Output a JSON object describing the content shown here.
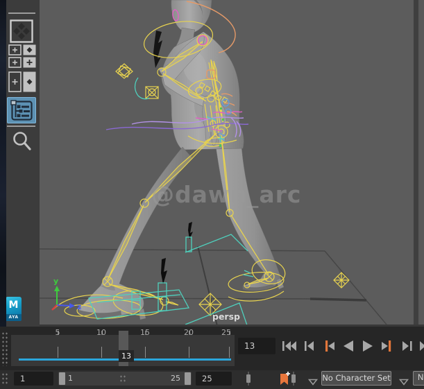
{
  "sidebar": {
    "maya_logo": {
      "m": "M",
      "sub": "AYA"
    }
  },
  "viewport": {
    "camera_label": "persp",
    "watermark": "@dawn_arc",
    "axis_labels": {
      "y": "y",
      "z": "z"
    }
  },
  "timeline": {
    "ticks": [
      "5",
      "10",
      "15",
      "20",
      "25"
    ],
    "playhead_frame": "13",
    "frame_field_value": "13"
  },
  "range_bar": {
    "start_field": "1",
    "slider_start_label": "1",
    "slider_end_label": "25",
    "end_field": "25",
    "character_set_label": "No Character Set",
    "clipped_label": "N"
  },
  "colors": {
    "cached_playback_cyan": "#2ba7dc",
    "selected_tool_blue": "#5d92b4",
    "key_tick_orange": "#e2763a",
    "rig_yellow": "#e8d34f",
    "control_teal": "#4fd0bd",
    "control_magenta": "#e25fc4",
    "control_purple": "#b392e8",
    "axis_y_green": "#3ecc3e",
    "axis_z_blue": "#5868f0",
    "axis_x_red": "#d84040"
  }
}
